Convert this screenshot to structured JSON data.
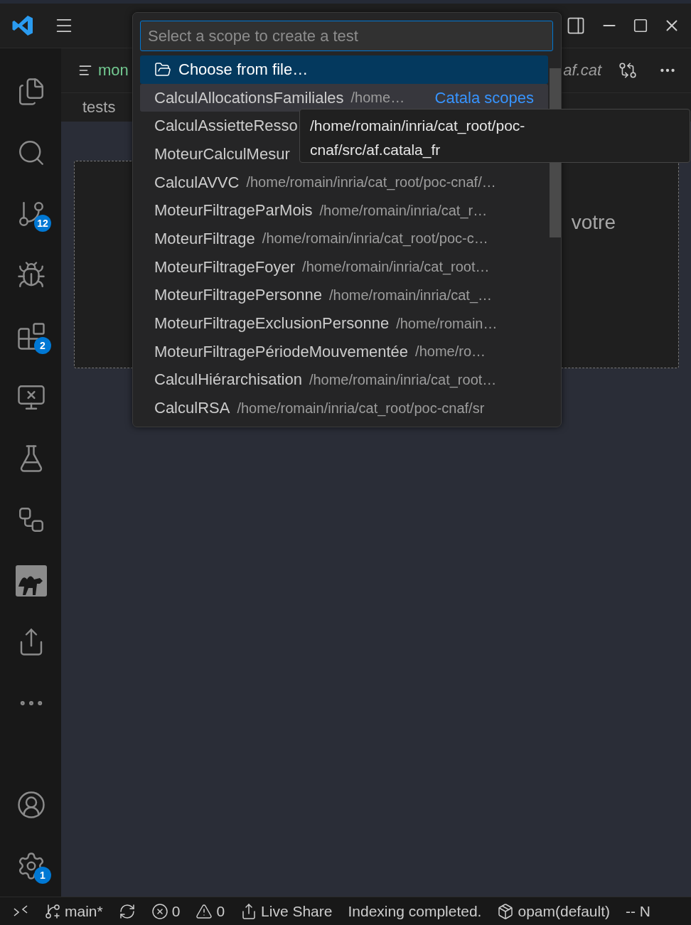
{
  "title_bar": {
    "has_logo": true
  },
  "activity_bar": {
    "items": [
      {
        "kind": "files",
        "selected": false
      },
      {
        "kind": "search",
        "selected": false
      },
      {
        "kind": "source-control",
        "selected": false,
        "badge": "12"
      },
      {
        "kind": "run-debug",
        "selected": false
      },
      {
        "kind": "extensions",
        "selected": false,
        "badge": "2"
      },
      {
        "kind": "remote",
        "selected": false
      },
      {
        "kind": "testing",
        "selected": false
      },
      {
        "kind": "structure",
        "selected": false
      },
      {
        "kind": "ocaml",
        "selected": false
      },
      {
        "kind": "live-share",
        "selected": false
      },
      {
        "kind": "more",
        "selected": false
      }
    ],
    "bottom": [
      {
        "kind": "account"
      },
      {
        "kind": "settings",
        "badge": "1"
      }
    ]
  },
  "editor": {
    "tab": {
      "label": "mon"
    },
    "right_tab_label": "af.cat",
    "breadcrumb": "tests",
    "content_text": "votre"
  },
  "quick_pick": {
    "placeholder": "Select a scope to create a test",
    "items": [
      {
        "kind": "action",
        "label": "Choose from file…",
        "selected": true
      },
      {
        "kind": "scope",
        "label": "CalculAllocationsFamiliales",
        "description": "/home…",
        "detail": "Catala scopes",
        "selected": false,
        "hovered": true
      },
      {
        "kind": "scope",
        "label": "CalculAssietteResso",
        "selected": false,
        "hovered": false
      },
      {
        "kind": "scope",
        "label": "MoteurCalculMesur",
        "selected": false,
        "hovered": false
      },
      {
        "kind": "scope",
        "label": "CalculAVVC",
        "description": "/home/romain/inria/cat_root/poc-cnaf/…",
        "selected": false,
        "hovered": false
      },
      {
        "kind": "scope",
        "label": "MoteurFiltrageParMois",
        "description": "/home/romain/inria/cat_r…",
        "selected": false,
        "hovered": false
      },
      {
        "kind": "scope",
        "label": "MoteurFiltrage",
        "description": "/home/romain/inria/cat_root/poc-c…",
        "selected": false,
        "hovered": false
      },
      {
        "kind": "scope",
        "label": "MoteurFiltrageFoyer",
        "description": "/home/romain/inria/cat_root…",
        "selected": false,
        "hovered": false
      },
      {
        "kind": "scope",
        "label": "MoteurFiltragePersonne",
        "description": "/home/romain/inria/cat_…",
        "selected": false,
        "hovered": false
      },
      {
        "kind": "scope",
        "label": "MoteurFiltrageExclusionPersonne",
        "description": "/home/romain…",
        "selected": false,
        "hovered": false
      },
      {
        "kind": "scope",
        "label": "MoteurFiltragePériodeMouvementée",
        "description": "/home/ro…",
        "selected": false,
        "hovered": false
      },
      {
        "kind": "scope",
        "label": "CalculHiérarchisation",
        "description": "/home/romain/inria/cat_root…",
        "selected": false,
        "hovered": false
      },
      {
        "kind": "scope",
        "label": "CalculRSA",
        "description": "/home/romain/inria/cat_root/poc-cnaf/sr",
        "selected": false,
        "hovered": false
      }
    ],
    "tooltip": "/home/romain/inria/cat_root/poc-cnaf/src/af.catala_fr"
  },
  "status_bar": {
    "items": [
      {
        "kind": "remote"
      },
      {
        "kind": "branch",
        "text": "main*"
      },
      {
        "kind": "sync"
      },
      {
        "kind": "errors",
        "text": "0"
      },
      {
        "kind": "warnings",
        "text": "0"
      },
      {
        "kind": "live-share",
        "text": "Live Share"
      },
      {
        "kind": "plain",
        "text": "Indexing completed."
      },
      {
        "kind": "opam",
        "text": "opam(default)"
      },
      {
        "kind": "plain",
        "text": "-- N"
      }
    ]
  }
}
